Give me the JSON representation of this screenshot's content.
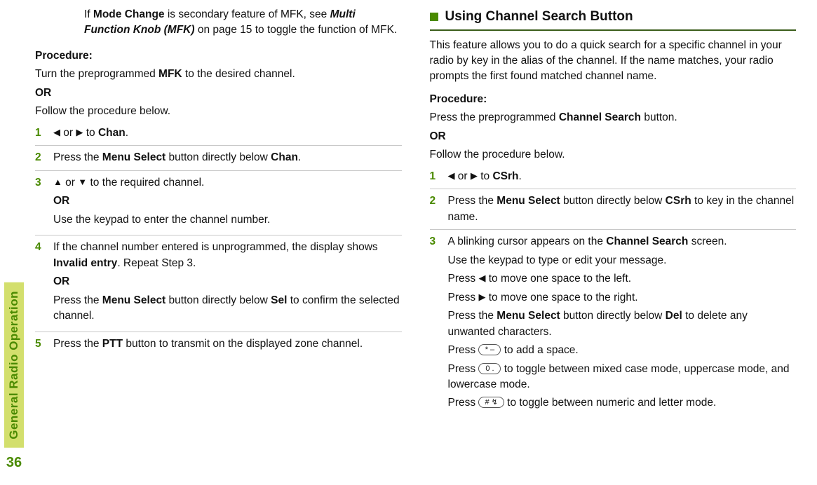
{
  "side": {
    "label": "General Radio Operation",
    "page_number": "36"
  },
  "left": {
    "note": {
      "t1": "If ",
      "b1": "Mode Change",
      "t2": " is secondary feature of MFK, see ",
      "bi1": "Multi Function Knob (MFK)",
      "t3": " on page 15 to toggle the function of MFK."
    },
    "procedure_label": "Procedure:",
    "proc_line1a": "Turn the preprogrammed ",
    "proc_line1b": "MFK",
    "proc_line1c": " to the desired channel.",
    "or": "OR",
    "proc_line2": "Follow the procedure below.",
    "steps": {
      "s1": {
        "num": "1",
        "a": " or ",
        "to": " to ",
        "chan": "Chan",
        "end": "."
      },
      "s2": {
        "num": "2",
        "a": "Press the ",
        "b": "Menu Select",
        "c": " button directly below ",
        "chan": "Chan",
        "d": "."
      },
      "s3": {
        "num": "3",
        "a": " or ",
        "b": " to the required channel.",
        "or": "OR",
        "c": "Use the keypad to enter the channel number."
      },
      "s4": {
        "num": "4",
        "a": "If the channel number entered is unprogrammed, the display shows ",
        "inv": "Invalid entry",
        "b": ". Repeat Step 3.",
        "or": "OR",
        "c": "Press the ",
        "d": "Menu Select",
        "e": " button directly below ",
        "sel": "Sel",
        "f": " to confirm the selected channel."
      },
      "s5": {
        "num": "5",
        "a": "Press the ",
        "b": "PTT",
        "c": " button to transmit on the displayed zone channel."
      }
    }
  },
  "right": {
    "heading": "Using Channel Search Button",
    "intro": "This feature allows you to do a quick search for a specific channel in your radio by key in the alias of the channel. If the name matches, your radio prompts the first found matched channel name.",
    "procedure_label": "Procedure:",
    "proc_line1a": "Press the preprogrammed ",
    "proc_line1b": "Channel Search",
    "proc_line1c": " button.",
    "or": "OR",
    "proc_line2": "Follow the procedure below.",
    "steps": {
      "s1": {
        "num": "1",
        "a": " or ",
        "to": " to ",
        "csrh": "CSrh",
        "end": "."
      },
      "s2": {
        "num": "2",
        "a": "Press the ",
        "b": "Menu Select",
        "c": " button directly below ",
        "csrh": "CSrh",
        "d": " to key in the channel name."
      },
      "s3": {
        "num": "3",
        "a": "A blinking cursor appears on the ",
        "scr": "Channel Search",
        "b": " screen.",
        "c": "Use the keypad to type or edit your message.",
        "d1": "Press ",
        "d2": " to move one space to the left.",
        "e1": "Press ",
        "e2": " to move one space to the right.",
        "f1": "Press the ",
        "f2": "Menu Select",
        "f3": " button directly below ",
        "del": "Del",
        "f4": " to delete any unwanted characters.",
        "g1": "Press ",
        "g2": " to add a space.",
        "h1": "Press ",
        "h2": " to toggle between mixed case mode, uppercase mode, and lowercase mode.",
        "i1": "Press ",
        "i2": " to toggle between numeric and letter mode."
      }
    },
    "keycaps": {
      "star": "*  –",
      "zero": "0  .",
      "hash": "#  ↯"
    }
  }
}
